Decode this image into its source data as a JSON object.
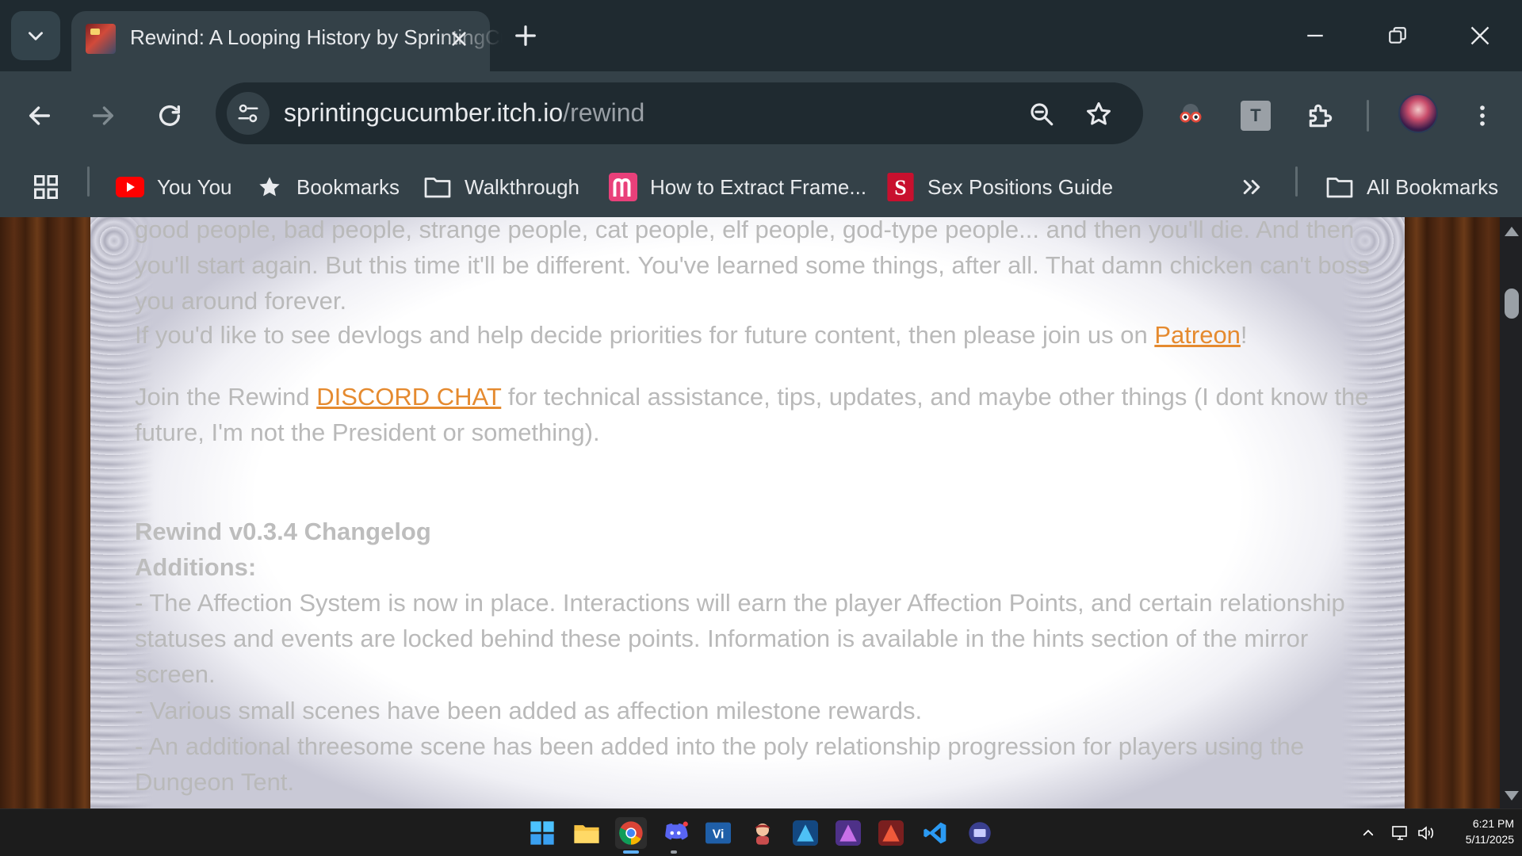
{
  "browser": {
    "tab": {
      "title": "Rewind: A Looping History by SprintingCucumber"
    },
    "url": {
      "host": "sprintingcucumber.itch.io",
      "path": "/rewind"
    },
    "bookmarks": [
      {
        "label": "You You",
        "icon": "youtube-icon"
      },
      {
        "label": "Bookmarks",
        "icon": "star-icon"
      },
      {
        "label": "Walkthrough",
        "icon": "folder-icon"
      },
      {
        "label": "How to Extract Frame...",
        "icon": "m-logo-icon"
      },
      {
        "label": "Sex Positions Guide",
        "icon": "s-logo-icon"
      }
    ],
    "all_bookmarks_label": "All Bookmarks",
    "extension_letter": "T"
  },
  "page": {
    "para1": "good people, bad people, strange people, cat people, elf people, god-type people... and then you'll die. And then you'll start again. But this time it'll be different. You've learned some things, after all. That damn chicken can't boss you around forever.",
    "para2_pre": "If you'd like to see devlogs and help decide priorities for future content, then please join us on ",
    "para2_link": "Patreon",
    "para2_post": "!",
    "para3_pre": "Join the Rewind ",
    "para3_link": "DISCORD CHAT",
    "para3_post": " for technical assistance, tips, updates, and maybe other things (I dont know the future, I'm not the President or something).",
    "changelog_title": "Rewind v0.3.4 Changelog",
    "additions_title": "Additions:",
    "items": [
      "- The Affection System is now in place. Interactions will earn the player Affection Points, and certain relationship statuses and events are locked behind these points. Information is available in the hints section of the mirror screen.",
      "- Various small scenes have been added as affection milestone rewards.",
      "- An additional threesome scene has been added into the poly relationship progression for players using the Dungeon Tent."
    ],
    "link_color": "#e58a2f"
  },
  "taskbar": {
    "time": "6:21 PM",
    "date": "5/11/2025",
    "apps": [
      "windows-start-icon",
      "file-explorer-icon",
      "chrome-icon",
      "discord-icon",
      "vi-app-icon",
      "game-character-icon",
      "affinity-designer-icon",
      "affinity-photo-icon",
      "affinity-publisher-icon",
      "vscode-icon",
      "keyboard-app-icon"
    ]
  }
}
